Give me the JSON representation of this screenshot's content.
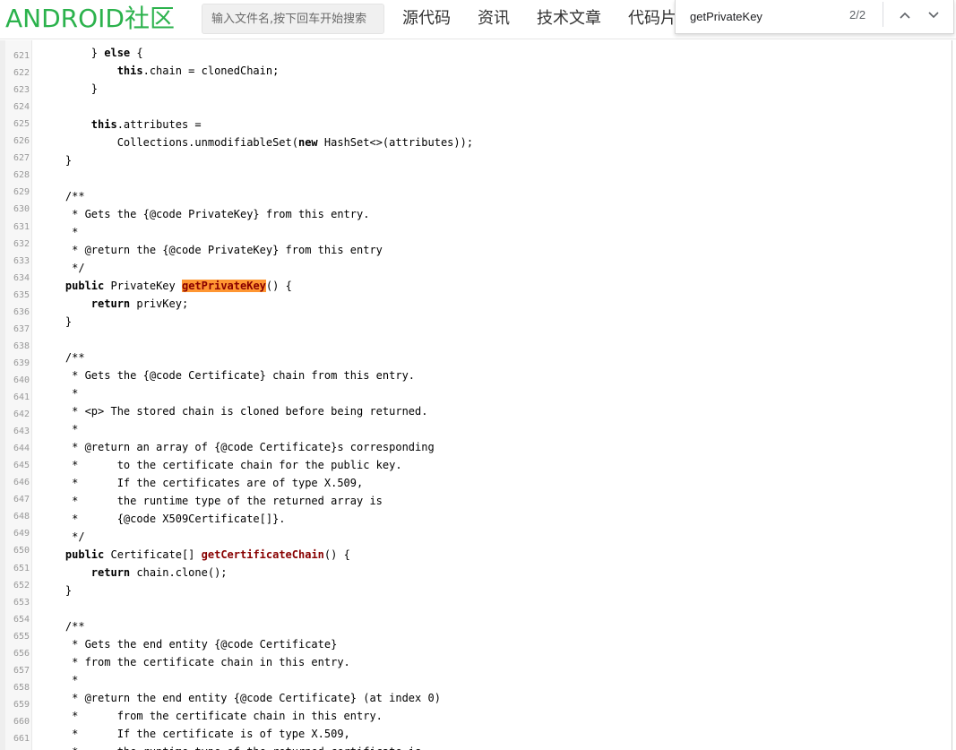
{
  "header": {
    "logo": "ANDROID社区",
    "search_placeholder": "输入文件名,按下回车开始搜索",
    "nav": [
      "源代码",
      "资讯",
      "技术文章",
      "代码片段"
    ]
  },
  "findbar": {
    "query": "getPrivateKey",
    "count": "2/2"
  },
  "code": {
    "lines": [
      {
        "n": "621",
        "segs": [
          {
            "t": "        } "
          },
          {
            "t": "else",
            "c": "kw"
          },
          {
            "t": " {"
          }
        ]
      },
      {
        "n": "622",
        "segs": [
          {
            "t": "            "
          },
          {
            "t": "this",
            "c": "kw"
          },
          {
            "t": ".chain = clonedChain;"
          }
        ]
      },
      {
        "n": "623",
        "segs": [
          {
            "t": "        }"
          }
        ]
      },
      {
        "n": "624",
        "segs": []
      },
      {
        "n": "625",
        "segs": [
          {
            "t": "        "
          },
          {
            "t": "this",
            "c": "kw"
          },
          {
            "t": ".attributes ="
          }
        ]
      },
      {
        "n": "626",
        "segs": [
          {
            "t": "            Collections.unmodifiableSet("
          },
          {
            "t": "new",
            "c": "kw"
          },
          {
            "t": " HashSet<>(attributes));"
          }
        ]
      },
      {
        "n": "627",
        "segs": [
          {
            "t": "    }"
          }
        ]
      },
      {
        "n": "628",
        "segs": []
      },
      {
        "n": "629",
        "segs": [
          {
            "t": "    /**"
          }
        ]
      },
      {
        "n": "630",
        "segs": [
          {
            "t": "     * Gets the {@code PrivateKey} from this entry."
          }
        ]
      },
      {
        "n": "631",
        "segs": [
          {
            "t": "     *"
          }
        ]
      },
      {
        "n": "632",
        "segs": [
          {
            "t": "     * @return the {@code PrivateKey} from this entry"
          }
        ]
      },
      {
        "n": "633",
        "segs": [
          {
            "t": "     */"
          }
        ]
      },
      {
        "n": "634",
        "segs": [
          {
            "t": "    "
          },
          {
            "t": "public",
            "c": "kw"
          },
          {
            "t": " PrivateKey "
          },
          {
            "t": "getPrivateKey",
            "c": "fn hl"
          },
          {
            "t": "() {"
          }
        ]
      },
      {
        "n": "635",
        "segs": [
          {
            "t": "        "
          },
          {
            "t": "return",
            "c": "kw"
          },
          {
            "t": " privKey;"
          }
        ]
      },
      {
        "n": "636",
        "segs": [
          {
            "t": "    }"
          }
        ]
      },
      {
        "n": "637",
        "segs": []
      },
      {
        "n": "638",
        "segs": [
          {
            "t": "    /**"
          }
        ]
      },
      {
        "n": "639",
        "segs": [
          {
            "t": "     * Gets the {@code Certificate} chain from this entry."
          }
        ]
      },
      {
        "n": "640",
        "segs": [
          {
            "t": "     *"
          }
        ]
      },
      {
        "n": "641",
        "segs": [
          {
            "t": "     * <p> The stored chain is cloned before being returned."
          }
        ]
      },
      {
        "n": "642",
        "segs": [
          {
            "t": "     *"
          }
        ]
      },
      {
        "n": "643",
        "segs": [
          {
            "t": "     * @return an array of {@code Certificate}s corresponding"
          }
        ]
      },
      {
        "n": "644",
        "segs": [
          {
            "t": "     *      to the certificate chain for the public key."
          }
        ]
      },
      {
        "n": "645",
        "segs": [
          {
            "t": "     *      If the certificates are of type X.509,"
          }
        ]
      },
      {
        "n": "646",
        "segs": [
          {
            "t": "     *      the runtime type of the returned array is"
          }
        ]
      },
      {
        "n": "647",
        "segs": [
          {
            "t": "     *      {@code X509Certificate[]}."
          }
        ]
      },
      {
        "n": "648",
        "segs": [
          {
            "t": "     */"
          }
        ]
      },
      {
        "n": "649",
        "segs": [
          {
            "t": "    "
          },
          {
            "t": "public",
            "c": "kw"
          },
          {
            "t": " Certificate[] "
          },
          {
            "t": "getCertificateChain",
            "c": "fn"
          },
          {
            "t": "() {"
          }
        ]
      },
      {
        "n": "650",
        "segs": [
          {
            "t": "        "
          },
          {
            "t": "return",
            "c": "kw"
          },
          {
            "t": " chain.clone();"
          }
        ]
      },
      {
        "n": "651",
        "segs": [
          {
            "t": "    }"
          }
        ]
      },
      {
        "n": "652",
        "segs": []
      },
      {
        "n": "653",
        "segs": [
          {
            "t": "    /**"
          }
        ]
      },
      {
        "n": "654",
        "segs": [
          {
            "t": "     * Gets the end entity {@code Certificate}"
          }
        ]
      },
      {
        "n": "655",
        "segs": [
          {
            "t": "     * from the certificate chain in this entry."
          }
        ]
      },
      {
        "n": "656",
        "segs": [
          {
            "t": "     *"
          }
        ]
      },
      {
        "n": "657",
        "segs": [
          {
            "t": "     * @return the end entity {@code Certificate} (at index 0)"
          }
        ]
      },
      {
        "n": "658",
        "segs": [
          {
            "t": "     *      from the certificate chain in this entry."
          }
        ]
      },
      {
        "n": "659",
        "segs": [
          {
            "t": "     *      If the certificate is of type X.509,"
          }
        ]
      },
      {
        "n": "660",
        "segs": [
          {
            "t": "     *      the runtime type of the returned certificate is"
          }
        ]
      }
    ],
    "gutter_numbers": [
      "621",
      "622",
      "623",
      "624",
      "625",
      "626",
      "627",
      "628",
      "629",
      "630",
      "631",
      "632",
      "633",
      "634",
      "635",
      "636",
      "637",
      "638",
      "639",
      "640",
      "641",
      "642",
      "643",
      "644",
      "645",
      "646",
      "647",
      "648",
      "649",
      "650",
      "651",
      "652",
      "653",
      "654",
      "655",
      "656",
      "657",
      "658",
      "659",
      "660",
      "661"
    ]
  },
  "colors": {
    "logo": "#2bb24c",
    "highlight": "#ff9632",
    "method_name": "#880000"
  },
  "icons": [
    "chevron-up-icon",
    "chevron-down-icon"
  ]
}
